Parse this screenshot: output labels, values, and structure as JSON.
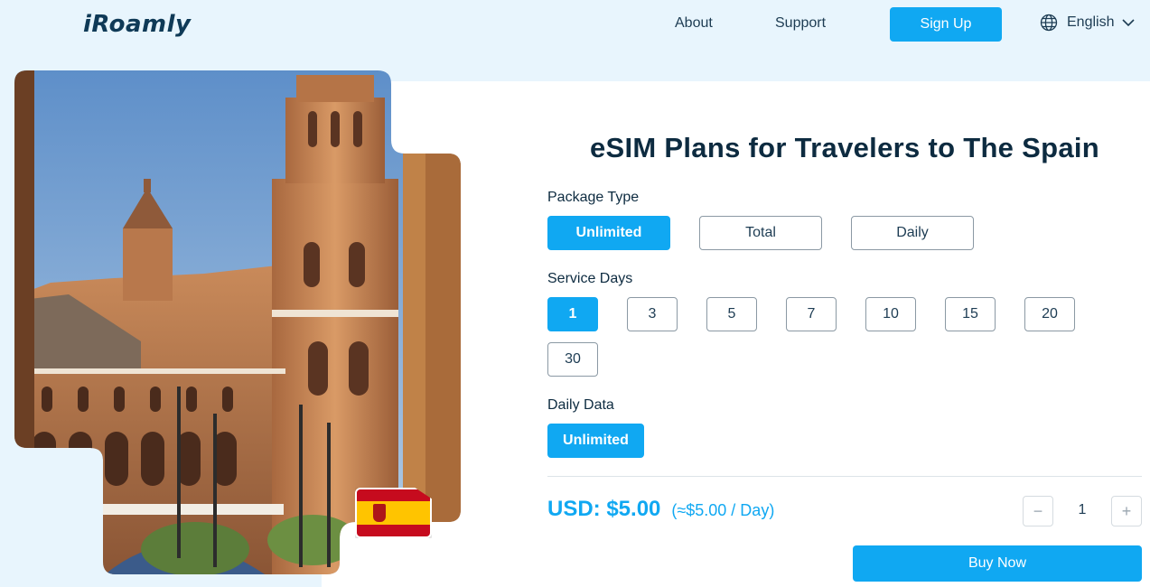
{
  "header": {
    "logo": "iRoamly",
    "nav": [
      "About",
      "Support"
    ],
    "signup_label": "Sign Up",
    "language": "English"
  },
  "main": {
    "title": "eSIM Plans for Travelers to The Spain",
    "package_type": {
      "label": "Package Type",
      "options": [
        "Unlimited",
        "Total",
        "Daily"
      ],
      "selected": "Unlimited"
    },
    "service_days": {
      "label": "Service Days",
      "options": [
        "1",
        "3",
        "5",
        "7",
        "10",
        "15",
        "20",
        "30"
      ],
      "selected": "1"
    },
    "daily_data": {
      "label": "Daily Data",
      "options": [
        "Unlimited"
      ],
      "selected": "Unlimited"
    },
    "price": {
      "amount": "USD: $5.00",
      "per_day": "(≈$5.00 / Day)"
    },
    "quantity": {
      "value": "1",
      "minus": "−",
      "plus": "+"
    },
    "buy_label": "Buy Now"
  },
  "colors": {
    "accent": "#10a8f2",
    "heading": "#0d2b40",
    "panel_bg": "#e8f5fd"
  }
}
